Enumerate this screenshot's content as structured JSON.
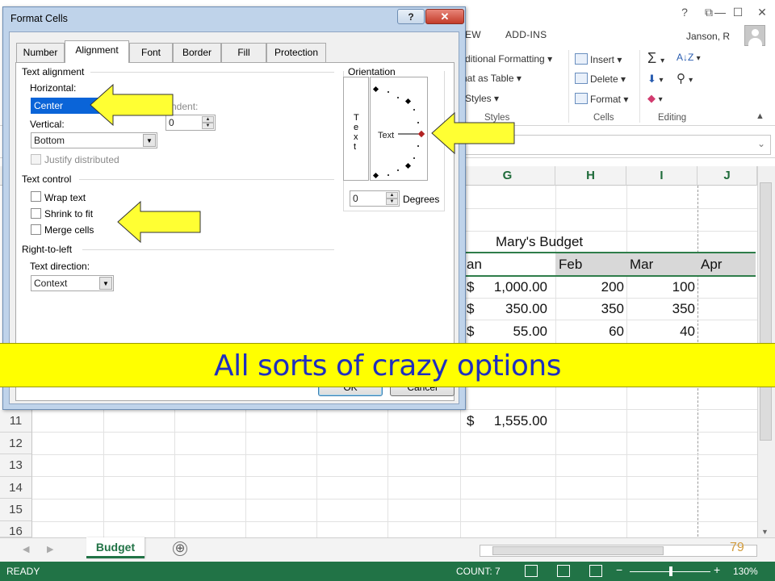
{
  "excel": {
    "ribbon_tabs": [
      "EW",
      "ADD-INS"
    ],
    "user_name": "Janson, R",
    "window_controls": {
      "help": "?",
      "restore": "⧉",
      "minimize": "—",
      "maximize": "☐",
      "close": "✕"
    },
    "styles_group": {
      "label": "Styles",
      "conditional_formatting": "ditional Formatting",
      "format_as_table": "nat as Table",
      "cell_styles": "Styles"
    },
    "cells_group": {
      "label": "Cells",
      "insert": "Insert",
      "delete": "Delete",
      "format": "Format"
    },
    "editing_group": {
      "label": "Editing"
    },
    "columns": [
      "G",
      "H",
      "I",
      "J"
    ],
    "rows": [
      "11",
      "12",
      "13",
      "14",
      "15",
      "16"
    ],
    "sheet": {
      "title": "Mary's Budget",
      "headers": [
        "an",
        "Feb",
        "Mar",
        "Apr"
      ],
      "data": [
        {
          "jan_sym": "$",
          "jan": "1,000.00",
          "feb": "200",
          "mar": "100"
        },
        {
          "jan_sym": "$",
          "jan": "350.00",
          "feb": "350",
          "mar": "350"
        },
        {
          "jan_sym": "$",
          "jan": "55.00",
          "feb": "60",
          "mar": "40"
        }
      ],
      "total_sym": "$",
      "total": "1,555.00"
    },
    "sheet_tab": "Budget",
    "add_sheet": "⊕",
    "slide_number": "79",
    "status": {
      "ready": "READY",
      "count": "COUNT: 7",
      "zoom": "130%",
      "zoom_minus": "−",
      "zoom_plus": "+"
    }
  },
  "dialog": {
    "title": "Format Cells",
    "help_button": "?",
    "close_button": "✕",
    "tabs": [
      "Number",
      "Alignment",
      "Font",
      "Border",
      "Fill",
      "Protection"
    ],
    "active_tab": "Alignment",
    "text_alignment": {
      "heading": "Text alignment",
      "horizontal_label": "Horizontal:",
      "horizontal_value": "Center",
      "indent_label": "ndent:",
      "indent_value": "0",
      "vertical_label": "Vertical:",
      "vertical_value": "Bottom",
      "justify_distributed": "Justify distributed"
    },
    "text_control": {
      "heading": "Text control",
      "wrap_text": "Wrap text",
      "shrink_to_fit": "Shrink to fit",
      "merge_cells": "Merge cells"
    },
    "right_to_left": {
      "heading": "Right-to-left",
      "direction_label": "Text direction:",
      "direction_value": "Context"
    },
    "orientation": {
      "heading": "Orientation",
      "vertical_text": [
        "T",
        "e",
        "x",
        "t"
      ],
      "dial_text": "Text",
      "degrees_value": "0",
      "degrees_label": "Degrees"
    },
    "ok_button": "OK",
    "cancel_button": "Cancel"
  },
  "banner": {
    "text": "All sorts of crazy options"
  },
  "colors": {
    "excel_green": "#217346",
    "banner_yellow": "#ffff00",
    "banner_text": "#1f2fbf",
    "arrow_fill": "#ffff33",
    "selection_blue": "#0a64d8"
  }
}
